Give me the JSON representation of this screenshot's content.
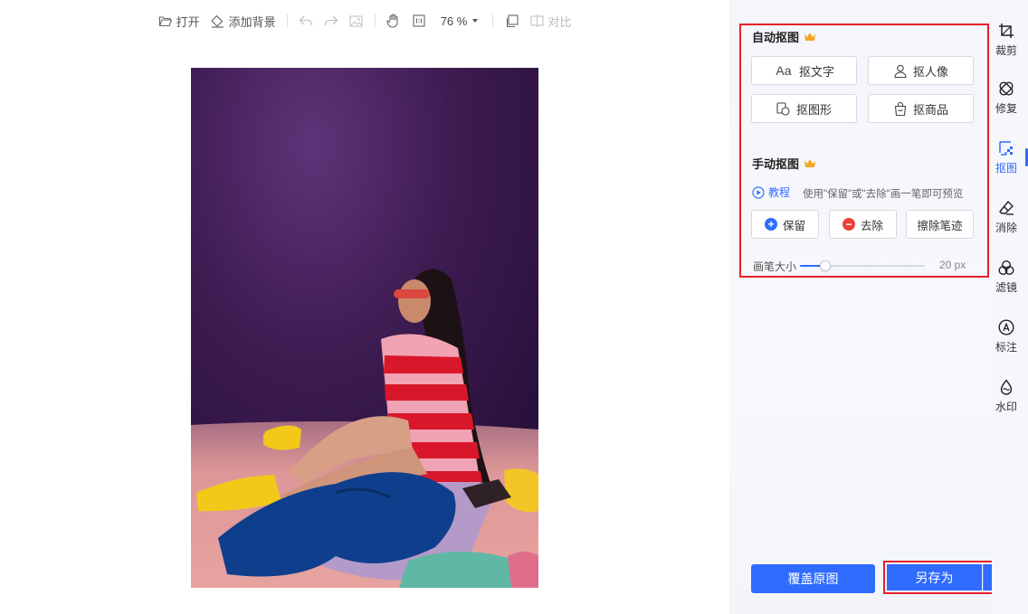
{
  "toolbar": {
    "open_label": "打开",
    "add_bg_label": "添加背景",
    "zoom_value": "76 %",
    "compare_label": "对比"
  },
  "auto_cutout": {
    "title": "自动抠图",
    "buttons": [
      {
        "label": "抠文字",
        "icon": "text-aa-icon"
      },
      {
        "label": "抠人像",
        "icon": "person-icon"
      },
      {
        "label": "抠图形",
        "icon": "shape-icon"
      },
      {
        "label": "抠商品",
        "icon": "shopping-bag-icon"
      }
    ]
  },
  "manual_cutout": {
    "title": "手动抠图",
    "tutorial_label": "教程",
    "hint": "使用\"保留\"或\"去除\"画一笔即可预览",
    "keep_label": "保留",
    "remove_label": "去除",
    "erase_strokes_label": "擦除笔迹",
    "brush_label": "画笔大小",
    "brush_value": "20  px",
    "brush_level": 0.2
  },
  "actions": {
    "cover_label": "覆盖原图",
    "save_as_label": "另存为"
  },
  "rail": [
    {
      "label": "裁剪",
      "icon": "crop-icon"
    },
    {
      "label": "修复",
      "icon": "bandage-icon"
    },
    {
      "label": "抠图",
      "icon": "cutout-icon",
      "active": true
    },
    {
      "label": "消除",
      "icon": "eraser-icon"
    },
    {
      "label": "滤镜",
      "icon": "filter-icon"
    },
    {
      "label": "标注",
      "icon": "annotate-icon"
    },
    {
      "label": "水印",
      "icon": "watermark-icon"
    }
  ],
  "colors": {
    "accent": "#2f6bff",
    "highlight_border": "#e5202a",
    "crown": "#f5a623",
    "keep": "#2f6bff",
    "remove": "#e8413a"
  }
}
